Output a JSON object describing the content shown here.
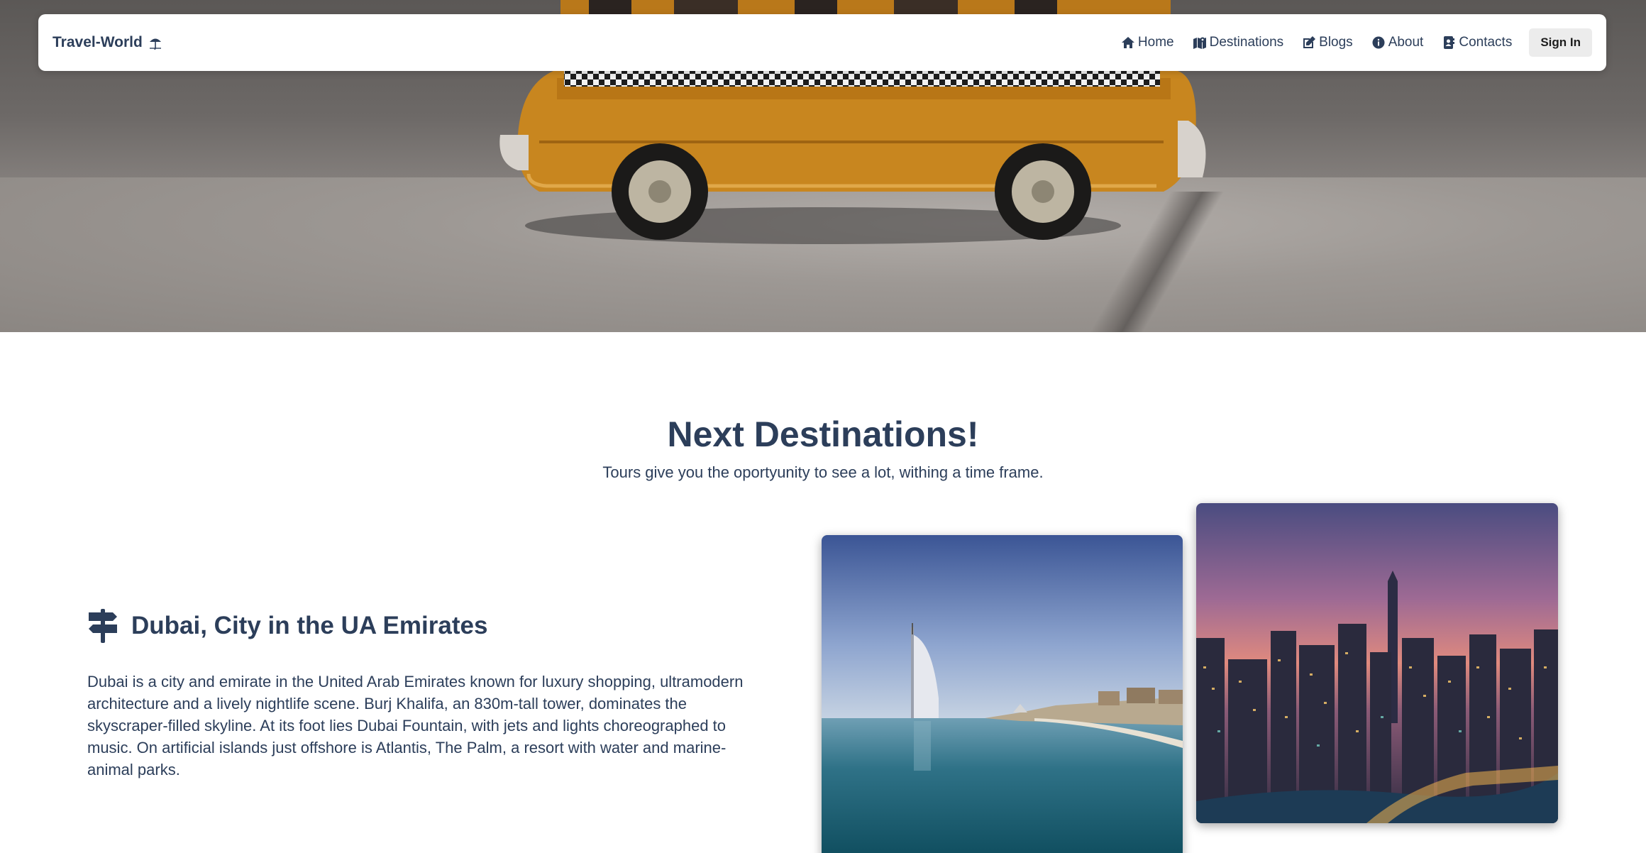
{
  "nav": {
    "brand": "Travel-World",
    "items": [
      {
        "label": "Home",
        "icon": "home-icon"
      },
      {
        "label": "Destinations",
        "icon": "map-icon"
      },
      {
        "label": "Blogs",
        "icon": "edit-icon"
      },
      {
        "label": "About",
        "icon": "info-icon"
      },
      {
        "label": "Contacts",
        "icon": "contact-book-icon"
      }
    ],
    "signin_label": "Sign In"
  },
  "section": {
    "title": "Next Destinations!",
    "subtitle": "Tours give you the oportyunity to see a lot, withing a time frame."
  },
  "destination": {
    "icon": "signpost-icon",
    "title": "Dubai, City in the UA Emirates",
    "description": "Dubai is a city and emirate in the United Arab Emirates known for luxury shopping, ultramodern architecture and a lively nightlife scene. Burj Khalifa, an 830m-tall tower, dominates the skyscraper-filled skyline. At its foot lies Dubai Fountain, with jets and lights choreographed to music. On artificial islands just offshore is Atlantis, The Palm, a resort with water and marine-animal parks."
  },
  "colors": {
    "text": "#2c3e5a",
    "signin_bg": "#ececec",
    "bus": "#c8861f"
  }
}
